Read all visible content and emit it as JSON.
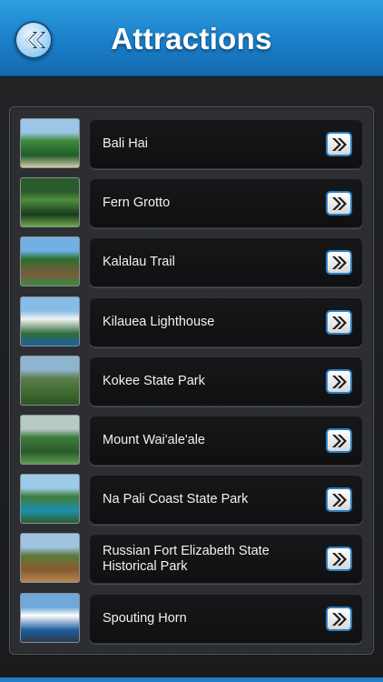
{
  "header": {
    "title": "Attractions",
    "back_icon": "double-chevron-left-icon"
  },
  "colors": {
    "header_blue": "#1a7fc9",
    "accent_border": "#2a7fc4",
    "background": "#1c1d1f"
  },
  "attractions": [
    {
      "label": "Bali Hai",
      "thumb": [
        "#9bc6e8",
        "#3f8a3a",
        "#1f5b2a",
        "#d7c9a6"
      ],
      "icon": "double-chevron-right-icon"
    },
    {
      "label": "Fern Grotto",
      "thumb": [
        "#2a5b2c",
        "#4e8e3d",
        "#1a3a1d",
        "#6aa84f"
      ],
      "icon": "double-chevron-right-icon"
    },
    {
      "label": "Kalalau Trail",
      "thumb": [
        "#6fb1e4",
        "#2b6e2f",
        "#7a5b3a",
        "#3d8a42"
      ],
      "icon": "double-chevron-right-icon"
    },
    {
      "label": "Kilauea Lighthouse",
      "thumb": [
        "#86bde8",
        "#f3f3f3",
        "#2f6f3a",
        "#1f5fa3"
      ],
      "icon": "double-chevron-right-icon"
    },
    {
      "label": "Kokee State Park",
      "thumb": [
        "#8fb4cf",
        "#5b7f4a",
        "#3e6b2f",
        "#2c5225"
      ],
      "icon": "double-chevron-right-icon"
    },
    {
      "label": "Mount Wai'ale'ale",
      "thumb": [
        "#b9c9c4",
        "#3d7d3c",
        "#2a5a2b",
        "#5c9b4e"
      ],
      "icon": "double-chevron-right-icon"
    },
    {
      "label": "Na Pali Coast State Park",
      "thumb": [
        "#9ccbe9",
        "#3f7c3a",
        "#1c8fb0",
        "#2e5f2a"
      ],
      "icon": "double-chevron-right-icon"
    },
    {
      "label": "Russian Fort Elizabeth State Historical Park",
      "thumb": [
        "#9fc3e0",
        "#5a7a3a",
        "#8a5a32",
        "#b3874f"
      ],
      "icon": "double-chevron-right-icon"
    },
    {
      "label": "Spouting Horn",
      "thumb": [
        "#6ea9d9",
        "#ffffff",
        "#1e5fa0",
        "#2d3a4a"
      ],
      "icon": "double-chevron-right-icon"
    }
  ]
}
